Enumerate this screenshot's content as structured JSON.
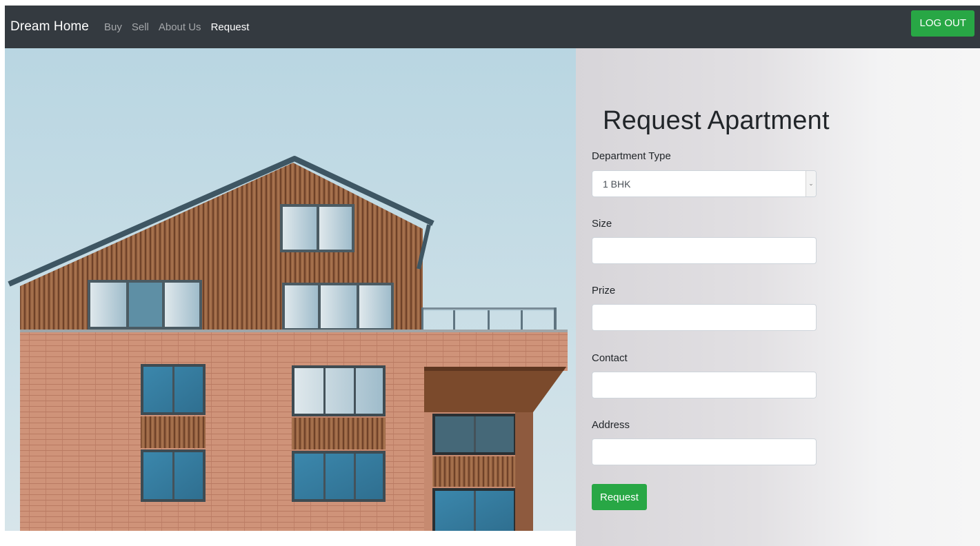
{
  "navbar": {
    "brand": "Dream Home",
    "links": [
      {
        "label": "Buy",
        "active": false
      },
      {
        "label": "Sell",
        "active": false
      },
      {
        "label": "About Us",
        "active": false
      },
      {
        "label": "Request",
        "active": true
      }
    ],
    "logout_label": "LOG OUT"
  },
  "hero": {
    "icon": "building-photo"
  },
  "form": {
    "title": "Request Apartment",
    "department_type": {
      "label": "Department Type",
      "value": "1 BHK"
    },
    "size": {
      "label": "Size",
      "value": ""
    },
    "prize": {
      "label": "Prize",
      "value": ""
    },
    "contact": {
      "label": "Contact",
      "value": ""
    },
    "address": {
      "label": "Address",
      "value": ""
    },
    "submit_label": "Request"
  },
  "colors": {
    "navbar_bg": "#343a40",
    "accent_green": "#28a745",
    "sky": "#c4dde6",
    "brick": "#c98a72",
    "wood": "#8a5a3c"
  }
}
